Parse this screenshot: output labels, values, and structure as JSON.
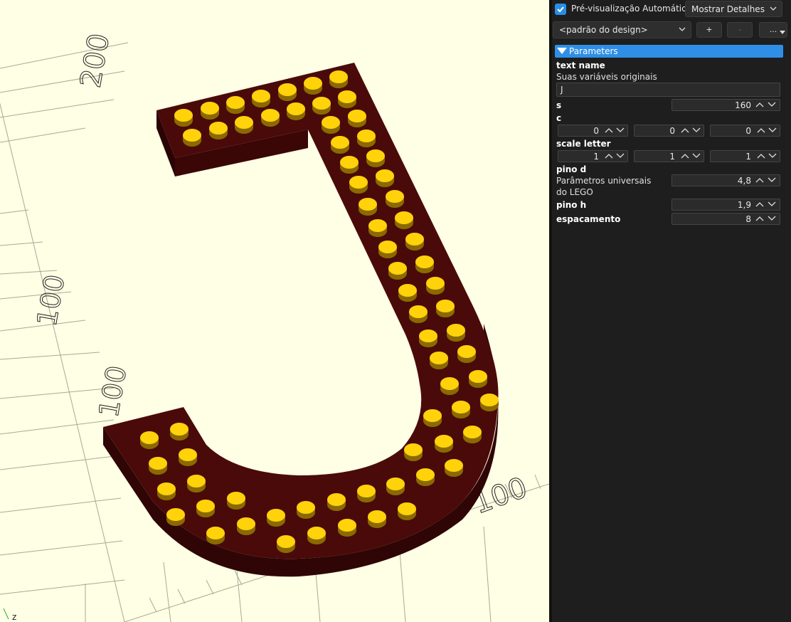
{
  "viewport": {
    "axis_labels": [
      "200",
      "100",
      "100",
      "100"
    ],
    "axis_letter": "z",
    "colors": {
      "background": "#ffffe5",
      "base": "#4a0a0a",
      "stud": "#ffd20a"
    }
  },
  "panel": {
    "auto_preview_label": "Pré-visualização Automática",
    "auto_preview_checked": true,
    "details_combo": "Mostrar Detalhes",
    "preset_combo": "<padrão do design>",
    "add_button": "+",
    "remove_button": "-",
    "more_button": "...",
    "section_title": "Parameters",
    "params": {
      "text_name": {
        "name": "text name",
        "desc": "Suas variáveis originais",
        "value": "J"
      },
      "s": {
        "name": "s",
        "value": "160"
      },
      "c": {
        "name": "c",
        "values": [
          "0",
          "0",
          "0"
        ]
      },
      "scale_letter": {
        "name": "scale letter",
        "values": [
          "1",
          "1",
          "1"
        ]
      },
      "pino_d": {
        "name": "pino d",
        "desc": "Parâmetros universais do LEGO",
        "value": "4,8"
      },
      "pino_h": {
        "name": "pino h",
        "value": "1,9"
      },
      "espacamento": {
        "name": "espacamento",
        "value": "8"
      }
    },
    "colors": {
      "accent": "#2f8fe6",
      "panel_bg": "#1e1e1e"
    }
  }
}
